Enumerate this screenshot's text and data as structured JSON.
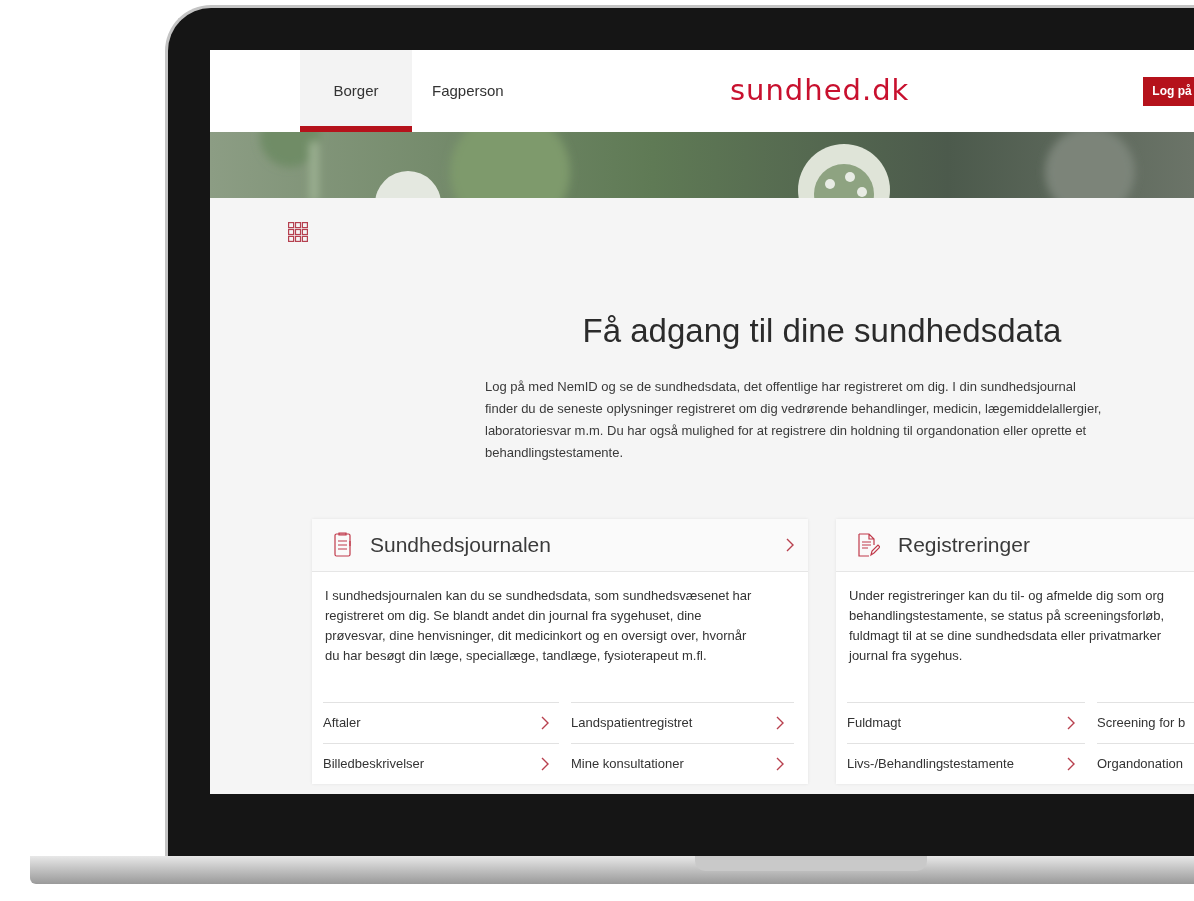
{
  "header": {
    "tabs": [
      {
        "label": "Borger",
        "selected": true
      },
      {
        "label": "Fagperson",
        "selected": false
      }
    ],
    "logo": "sundhed.dk",
    "login_button": "Log på"
  },
  "intro": {
    "title": "Få adgang til dine sundhedsdata",
    "text_lines": [
      "Log på med NemID og se de sundhedsdata, det offentlige har registreret om dig. I din sundhedsjournal",
      "finder du de seneste oplysninger registreret om dig vedrørende behandlinger, medicin, lægemiddelallergier,",
      "laboratoriesvar m.m. Du har også mulighed for at registrere din holdning til organdonation eller oprette et",
      "behandlingstestamente."
    ]
  },
  "cards": [
    {
      "kind": "journal",
      "title": "Sundhedsjournalen",
      "header_chevron": true,
      "text_lines": [
        "I sundhedsjournalen kan du se sundhedsdata, som sundhedsvæsenet har",
        "registreret om dig. Se blandt andet din journal fra sygehuset, dine",
        "prøvesvar, dine henvisninger, dit medicinkort og en oversigt over, hvornår",
        "du har besøgt din læge, speciallæge, tandlæge, fysioterapeut m.fl."
      ],
      "links": [
        [
          {
            "label": "Aftaler",
            "chevron": true
          },
          {
            "label": "Billedbeskrivelser",
            "chevron": true
          }
        ],
        [
          {
            "label": "Landspatientregistret",
            "chevron": true
          },
          {
            "label": "Mine konsultationer",
            "chevron": true
          }
        ]
      ]
    },
    {
      "kind": "registration",
      "title": "Registreringer",
      "header_chevron": false,
      "text_lines": [
        "Under registreringer kan du til- og afmelde dig som org",
        "behandlingstestamente, se status på screeningsforløb,",
        "fuldmagt til at se dine sundhedsdata eller privatmarker",
        "journal fra sygehus."
      ],
      "links": [
        [
          {
            "label": "Fuldmagt",
            "chevron": true
          },
          {
            "label": "Livs-/Behandlingstestamente",
            "chevron": true
          }
        ],
        [
          {
            "label": "Screening for b",
            "chevron": false
          },
          {
            "label": "Organdonation",
            "chevron": false
          }
        ]
      ]
    }
  ]
}
